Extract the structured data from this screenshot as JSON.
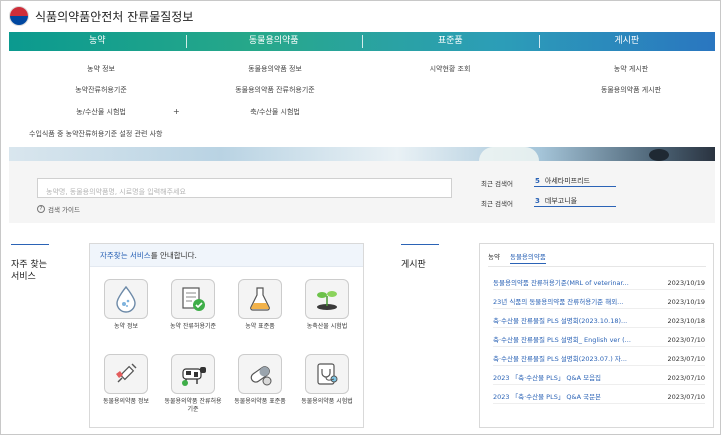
{
  "header": {
    "title": "식품의약품안전처 잔류물질정보"
  },
  "gnb": [
    "농약",
    "동물용의약품",
    "표준품",
    "게시판"
  ],
  "mega_menu": {
    "col1": [
      "농약 정보",
      "농약잔류허용기준",
      "농/수산물 시험법"
    ],
    "col2": [
      "동물용의약품 정보",
      "동물용의약품 잔류허용기준",
      "축/수산물 시험법"
    ],
    "col3": [
      "시약현황 조회"
    ],
    "col4": [
      "농약 게시판",
      "동물용의약품 게시판"
    ],
    "plus": "+",
    "extra": "수입식품 중 농약잔류허용기준 설정 관련 사항"
  },
  "search": {
    "placeholder": "농약명, 동물용의약품명, 시료명을 입력해주세요",
    "guide": "검색 가이드",
    "guide_icon": "?",
    "recent_label_1": "최근 검색어",
    "recent_num_1": "5",
    "recent_text_1": "아세타미프리드",
    "recent_label_2": "최근 검색어",
    "recent_num_2": "3",
    "recent_text_2": "데부고니올"
  },
  "frequent": {
    "title_line1": "자주 찾는",
    "title_line2": "서비스",
    "header_highlight": "자주찾는 서비스",
    "header_rest": "를 안내합니다.",
    "items": [
      {
        "icon": "water-drop-icon",
        "label": "농약 정보"
      },
      {
        "icon": "certificate-check-icon",
        "label": "농약 잔류허용기준"
      },
      {
        "icon": "flask-icon",
        "label": "농약 표준품"
      },
      {
        "icon": "seedling-icon",
        "label": "농축산물 시험법"
      },
      {
        "icon": "syringe-icon",
        "label": "동물용의약품 정보"
      },
      {
        "icon": "cow-icon",
        "label": "동물용의약품 잔류허용기준"
      },
      {
        "icon": "pill-icon",
        "label": "동물용의약품 표준품"
      },
      {
        "icon": "stethoscope-icon",
        "label": "동물용의약품 시험법"
      }
    ]
  },
  "board": {
    "title": "게시판",
    "tabs": [
      "농약",
      "동물용의약품"
    ],
    "active_tab": 1,
    "posts": [
      {
        "title": "동물용의약품 잔류허용기준(MRL of veterinar...",
        "date": "2023/10/19"
      },
      {
        "title": "23년 식품의 동물용의약품 잔류허용기준 해외...",
        "date": "2023/10/19"
      },
      {
        "title": "축·수산물 잔류물질 PLS 설명회(2023.10.18)...",
        "date": "2023/10/18"
      },
      {
        "title": "축·수산물 잔류물질 PLS 설명회_ English ver (...",
        "date": "2023/07/10"
      },
      {
        "title": "축·수산물 잔류물질 PLS 설명회(2023.07.) 자...",
        "date": "2023/07/10"
      },
      {
        "title": "2023 「축·수산물 PLS」 Q&A 모음집",
        "date": "2023/07/10"
      },
      {
        "title": "2023 「축·수산물 PLS」 Q&A 국문본",
        "date": "2023/07/10"
      }
    ]
  },
  "colors": {
    "accent": "#2b63b6",
    "gnb_start": "#0b9a8f",
    "gnb_end": "#2a76c0"
  }
}
